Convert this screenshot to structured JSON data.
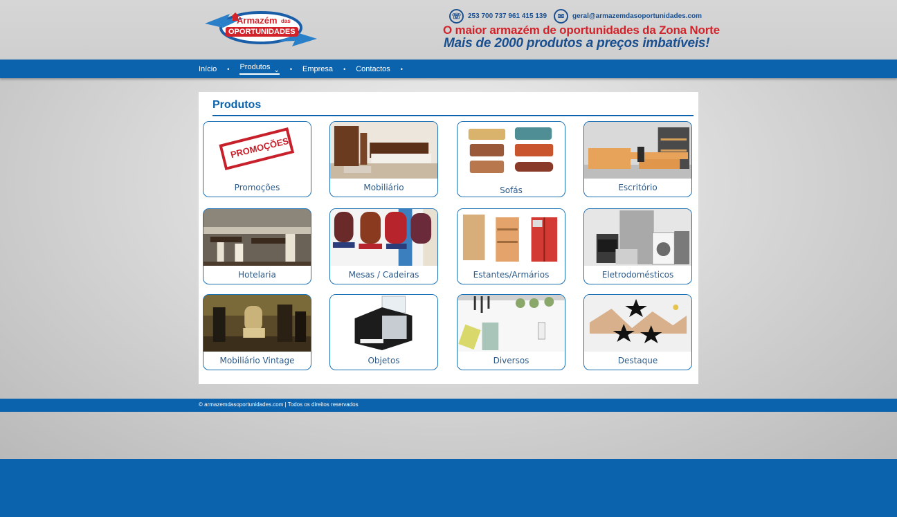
{
  "header": {
    "logo": {
      "line1": "Armazém",
      "line1_small": "das",
      "line2": "OPORTUNIDADES"
    },
    "phone": "253 700 737  961 415 139",
    "email": "geral@armazemdasoportunidades.com",
    "slogan1": "O maior armazém de oportunidades da Zona Norte",
    "slogan2": "Mais de 2000 produtos a preços imbatíveis!",
    "phone_icon": "phone-icon",
    "email_icon": "envelope-icon"
  },
  "nav": {
    "items": [
      {
        "label": "Início"
      },
      {
        "label": "Produtos"
      },
      {
        "label": "Empresa"
      },
      {
        "label": "Contactos"
      }
    ],
    "separator": "•"
  },
  "main": {
    "title": "Produtos",
    "categories": [
      {
        "label": "Promoções"
      },
      {
        "label": "Mobiliário"
      },
      {
        "label": "Sofás"
      },
      {
        "label": "Escritório"
      },
      {
        "label": "Hotelaria"
      },
      {
        "label": "Mesas / Cadeiras"
      },
      {
        "label": "Estantes/Armários"
      },
      {
        "label": "Eletrodomésticos"
      },
      {
        "label": "Mobiliário Vintage"
      },
      {
        "label": "Objetos"
      },
      {
        "label": "Diversos"
      },
      {
        "label": "Destaque"
      }
    ],
    "promo_stamp": "PROMOÇÕES"
  },
  "footer": {
    "text": "© armazemdasoportunidades.com | Todos os direitos reservados"
  },
  "colors": {
    "brand_blue": "#0c63ad",
    "brand_red": "#d3232a"
  }
}
